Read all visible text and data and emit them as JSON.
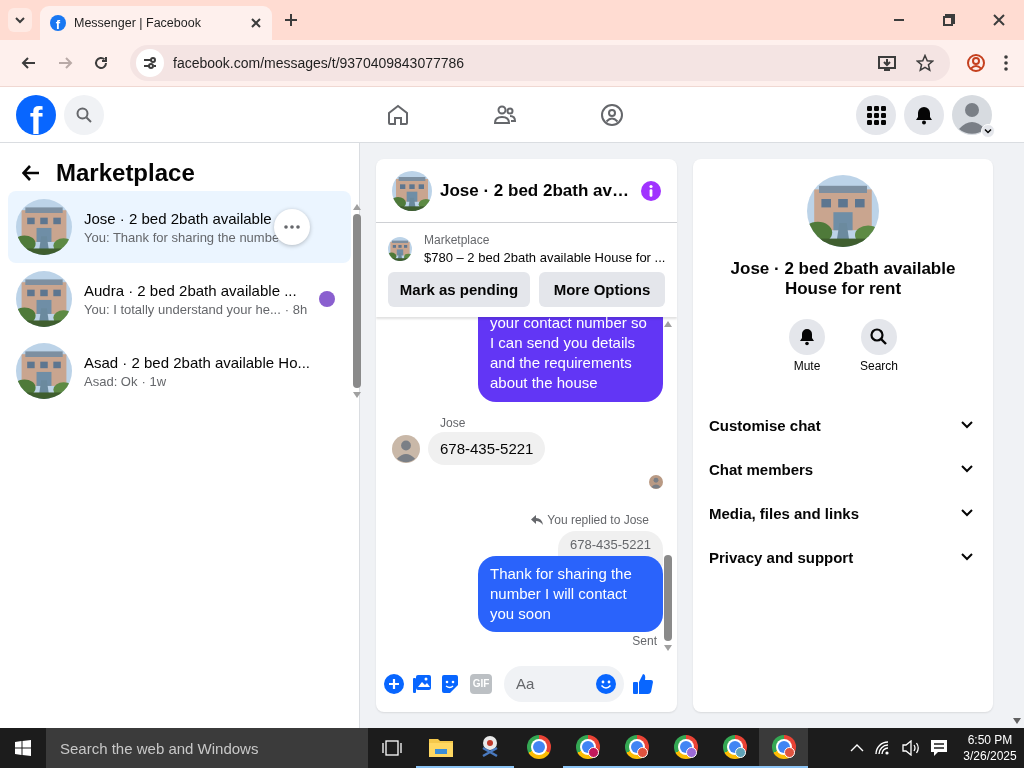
{
  "browser": {
    "favicon": "f",
    "tab_title": "Messenger | Facebook",
    "url": "facebook.com/messages/t/9370409843077786",
    "forward_disabled": true
  },
  "header": {
    "logo": "f"
  },
  "sidebar": {
    "title": "Marketplace",
    "conversations": [
      {
        "title": "Jose · 2 bed 2bath available",
        "preview": "You: Thank for sharing the numbe",
        "selected": true,
        "seen_avatar": false
      },
      {
        "title": "Audra · 2 bed 2bath available ...",
        "preview": "You: I totally understand your he...",
        "time": "· 8h",
        "selected": false,
        "seen_avatar": true
      },
      {
        "title": "Asad · 2 bed 2bath available Ho...",
        "preview": "Asad: Ok",
        "time": "· 1w",
        "selected": false,
        "seen_avatar": false
      }
    ]
  },
  "chat": {
    "title": "Jose · 2 bed 2bath av…",
    "listing": {
      "label": "Marketplace",
      "text": "$780 – 2 bed 2bath available House for ..."
    },
    "buttons": [
      "Mark as pending",
      "More Options"
    ],
    "messages": [
      {
        "kind": "outgoing",
        "text": "your contact number so I can send you details and the requirements about the house",
        "color": "#6236f5"
      },
      {
        "kind": "sender",
        "text": "Jose"
      },
      {
        "kind": "incoming",
        "text": "678-435-5221"
      },
      {
        "kind": "seen"
      },
      {
        "kind": "reply_note",
        "text": "You replied to Jose"
      },
      {
        "kind": "quote",
        "text": "678-435-5221"
      },
      {
        "kind": "outgoing",
        "text": "Thank for sharing  the number I will contact you soon",
        "color": "#2a63fb"
      },
      {
        "kind": "status",
        "text": "Sent"
      }
    ],
    "composer": {
      "gif_label": "GIF",
      "placeholder": "Aa"
    }
  },
  "info": {
    "title": "Jose · 2 bed 2bath available House for rent",
    "actions": [
      {
        "kind": "mute",
        "label": "Mute"
      },
      {
        "kind": "search",
        "label": "Search"
      }
    ],
    "sections": [
      {
        "label": "Customise chat",
        "expanded": false
      },
      {
        "label": "Chat members",
        "expanded": false
      },
      {
        "label": "Media, files and links",
        "expanded": false
      },
      {
        "label": "Privacy and support",
        "expanded": false
      }
    ]
  },
  "taskbar": {
    "search_placeholder": "Search the web and Windows",
    "apps": [
      {
        "kind": "explorer",
        "running": true,
        "active": false
      },
      {
        "kind": "snip",
        "running": true,
        "active": false
      },
      {
        "kind": "chrome",
        "running": false,
        "active": false
      },
      {
        "kind": "chrome",
        "color": "#c2185b",
        "running": true,
        "active": false
      },
      {
        "kind": "chrome",
        "color": "#e0533f",
        "running": true,
        "active": false
      },
      {
        "kind": "chrome",
        "color": "#9c6ad6",
        "running": true,
        "active": false
      },
      {
        "kind": "chrome",
        "color": "#5fa3b8",
        "running": true,
        "active": false
      },
      {
        "kind": "chrome",
        "color": "#e0533f",
        "running": true,
        "active": true
      }
    ],
    "time": "6:50 PM",
    "date": "3/26/2025"
  }
}
